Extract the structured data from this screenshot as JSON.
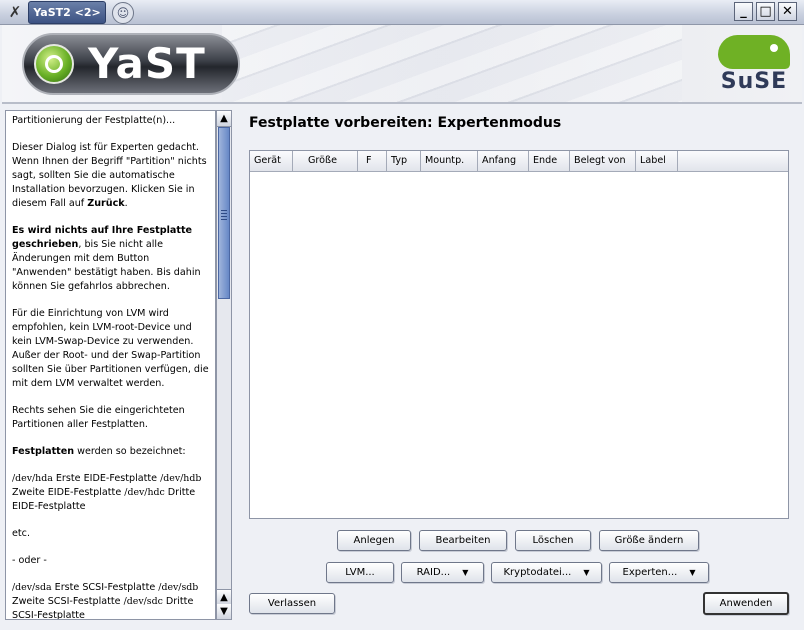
{
  "window": {
    "title": "YaST2 <2>",
    "controls": {
      "minimize": "_",
      "maximize": "□",
      "close": "✕"
    }
  },
  "banner": {
    "yast_logo": "YaST",
    "suse_logo": "SuSE"
  },
  "help": {
    "p1": "Partitionierung der Festplatte(n)...",
    "p2_a": "Dieser Dialog ist für Experten gedacht. Wenn Ihnen der Begriff \"Partition\" nichts sagt, sollten Sie die automatische Installation bevorzugen. Klicken Sie in diesem Fall auf ",
    "p2_b": "Zurück",
    "p2_c": ".",
    "p3_a": "Es wird nichts auf Ihre Festplatte geschrieben",
    "p3_b": ", bis Sie nicht alle Änderungen mit dem Button \"Anwenden\" bestätigt haben. Bis dahin können Sie gefahrlos abbrechen.",
    "p4": "Für die Einrichtung von LVM wird empfohlen, kein LVM-root-Device und kein LVM-Swap-Device zu verwenden. Außer der Root- und der Swap-Partition sollten Sie über Partitionen verfügen, die mit dem LVM verwaltet werden.",
    "p5": "Rechts sehen Sie die eingerichteten Partitionen aller Festplatten.",
    "p6_a": "Festplatten",
    "p6_b": " werden so bezeichnet:",
    "p7": {
      "c1": "/dev/hda",
      "t1": " Erste EIDE-Festplatte ",
      "c2": "/dev/hdb",
      "t2": " Zweite EIDE-Festplatte ",
      "c3": "/dev/hdc",
      "t3": " Dritte EIDE-Festplatte"
    },
    "p8": "etc.",
    "p9": "- oder -",
    "p10": {
      "c1": "/dev/sda",
      "t1": " Erste SCSI-Festplatte ",
      "c2": "/dev/sdb",
      "t2": " Zweite SCSI-Festplatte ",
      "c3": "/dev/sdc",
      "t3": " Dritte SCSI-Festplatte"
    }
  },
  "main": {
    "title": "Festplatte vorbereiten: Expertenmodus",
    "columns": [
      "Gerät",
      "Größe",
      "F",
      "Typ",
      "Mountp.",
      "Anfang",
      "Ende",
      "Belegt von",
      "Label"
    ],
    "rows": []
  },
  "buttons": {
    "anlegen": "Anlegen",
    "bearbeiten": "Bearbeiten",
    "loeschen": "Löschen",
    "groesse": "Größe ändern",
    "lvm": "LVM...",
    "raid": "RAID...",
    "krypto": "Kryptodatei...",
    "experten": "Experten...",
    "verlassen": "Verlassen",
    "anwenden": "Anwenden",
    "dropdown_icon": "▼"
  }
}
